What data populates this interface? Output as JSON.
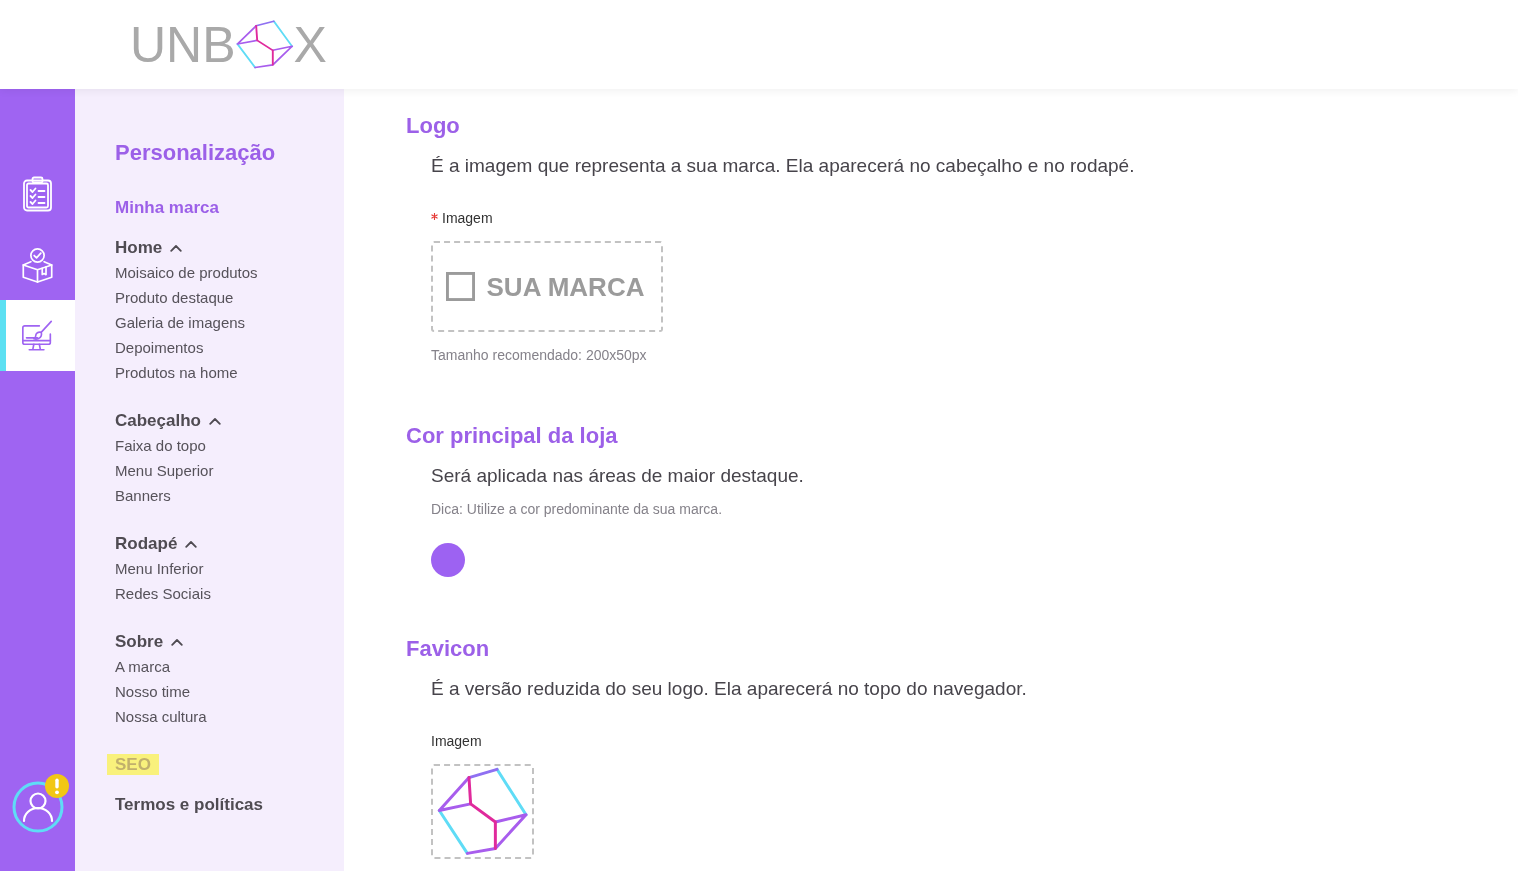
{
  "header": {
    "logo": {
      "text_start": "UNB",
      "text_end": "X"
    }
  },
  "rail": {
    "items": [
      {
        "selected": false
      },
      {
        "selected": false
      },
      {
        "selected": true
      }
    ],
    "account": {
      "alert": true
    }
  },
  "sidebar": {
    "title": "Personalização",
    "items": [
      {
        "kind": "link",
        "label": "Minha marca",
        "selected": true,
        "highlighted": false
      },
      {
        "kind": "group",
        "label": "Home",
        "selected": false,
        "highlighted": false,
        "expanded": true,
        "children": [
          {
            "label": "Moisaico de produtos",
            "selected": false
          },
          {
            "label": "Produto destaque",
            "selected": false
          },
          {
            "label": "Galeria de imagens",
            "selected": false
          },
          {
            "label": "Depoimentos",
            "selected": false
          },
          {
            "label": "Produtos na home",
            "selected": false
          }
        ]
      },
      {
        "kind": "group",
        "label": "Cabeçalho",
        "selected": false,
        "highlighted": false,
        "expanded": true,
        "children": [
          {
            "label": "Faixa do topo",
            "selected": false
          },
          {
            "label": "Menu Superior",
            "selected": false
          },
          {
            "label": "Banners",
            "selected": false
          }
        ]
      },
      {
        "kind": "group",
        "label": "Rodapé",
        "selected": false,
        "highlighted": false,
        "expanded": true,
        "children": [
          {
            "label": "Menu Inferior",
            "selected": false
          },
          {
            "label": "Redes Sociais",
            "selected": false
          }
        ]
      },
      {
        "kind": "group",
        "label": "Sobre",
        "selected": false,
        "highlighted": false,
        "expanded": true,
        "children": [
          {
            "label": "A marca",
            "selected": false
          },
          {
            "label": "Nosso time",
            "selected": false
          },
          {
            "label": "Nossa cultura",
            "selected": false
          }
        ]
      },
      {
        "kind": "link",
        "label": "SEO",
        "selected": false,
        "highlighted": true
      },
      {
        "kind": "link",
        "label": "Termos e políticas",
        "selected": false,
        "highlighted": false
      }
    ]
  },
  "main": {
    "sections": [
      {
        "kind": "image",
        "title": "Logo",
        "description": "É a imagem que representa a sua marca. Ela aparecerá no cabeçalho e no rodapé.",
        "field": {
          "label": "Imagem",
          "required": true,
          "preview": {
            "kind": "placeholder",
            "text": "SUA MARCA"
          }
        },
        "note": "Tamanho recomendado: 200x50px"
      },
      {
        "kind": "color",
        "title": "Cor principal da loja",
        "description": "Será aplicada nas áreas de maior destaque.",
        "hint": "Dica: Utilize a cor predominante da sua marca.",
        "color": "#9d62f2"
      },
      {
        "kind": "image",
        "title": "Favicon",
        "description": "É a versão reduzida do seu logo. Ela aparecerá no topo do navegador.",
        "field": {
          "label": "Imagem",
          "required": false,
          "preview": {
            "kind": "cube"
          }
        }
      }
    ]
  }
}
